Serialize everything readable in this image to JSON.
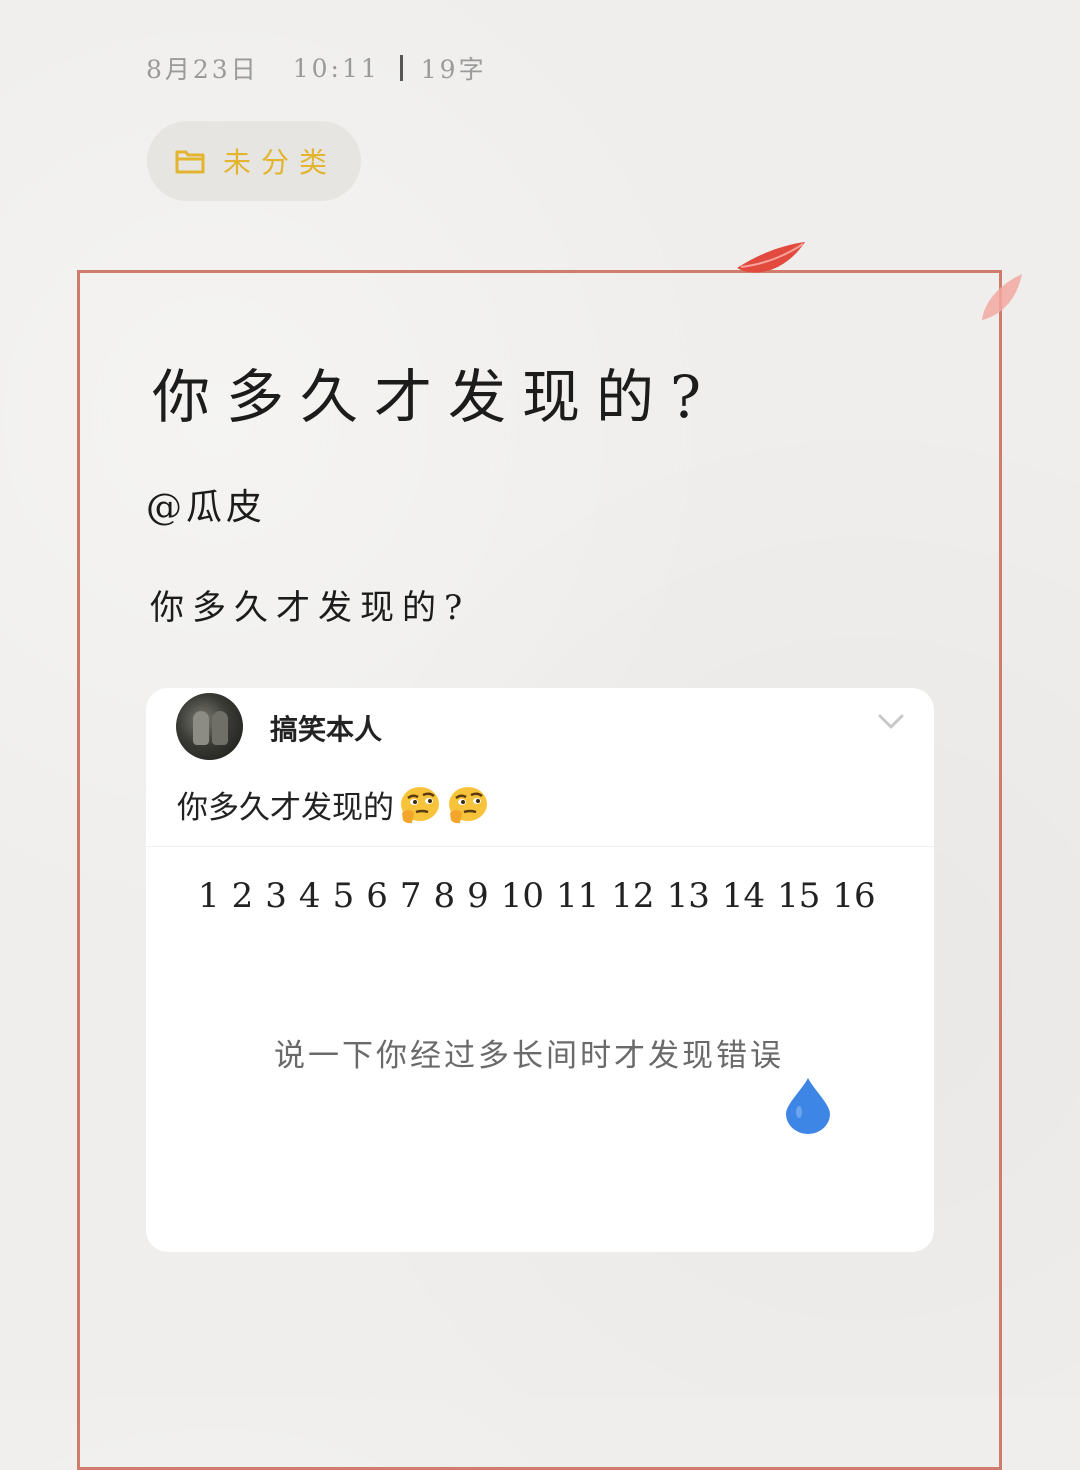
{
  "note": {
    "date": "8月23日",
    "time": "10:11",
    "word_count": "19字",
    "category": "未分类",
    "title": "你多久才发现的?",
    "author": "@瓜皮",
    "body": "你多久才发现的?"
  },
  "post": {
    "username": "搞笑本人",
    "text": "你多久才发现的",
    "emoji": "thinking-face-emoji",
    "numbers": [
      "1",
      "2",
      "3",
      "4",
      "5",
      "6",
      "7",
      "8",
      "9",
      "10",
      "11",
      "12",
      "13",
      "14",
      "15",
      "16"
    ],
    "caption": "说一下你经过多长间时才发现错误"
  },
  "colors": {
    "frame": "#d07c6c",
    "category": "#e2b430",
    "droplet": "#3d86e6",
    "petal": "#e24a3e"
  },
  "icons": [
    "folder-icon",
    "chevron-down-icon",
    "droplet-icon",
    "petal-icon"
  ]
}
